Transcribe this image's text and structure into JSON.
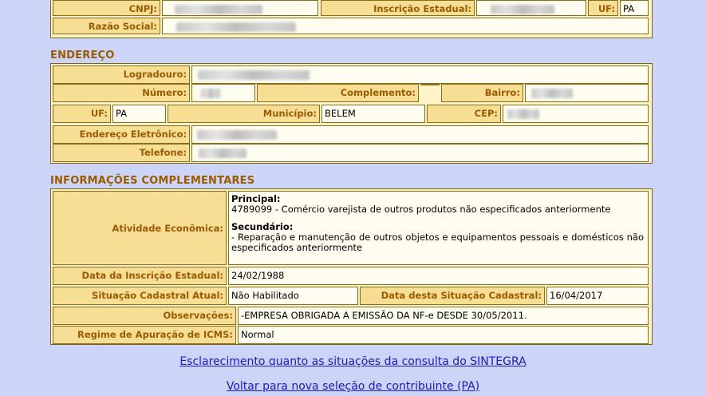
{
  "company": {
    "cnpj_label": "CNPJ:",
    "ie_label": "Inscrição Estadual:",
    "uf_label": "UF:",
    "uf_value": "PA",
    "razao_label": "Razão Social:"
  },
  "endereco": {
    "title": "ENDEREÇO",
    "logradouro_label": "Logradouro:",
    "numero_label": "Número:",
    "complemento_label": "Complemento:",
    "bairro_label": "Bairro:",
    "uf_label": "UF:",
    "uf_value": "PA",
    "municipio_label": "Município:",
    "municipio_value": "BELEM",
    "cep_label": "CEP:",
    "email_label": "Endereço Eletrônico:",
    "telefone_label": "Telefone:"
  },
  "info": {
    "title": "INFORMAÇÕES COMPLEMENTARES",
    "atividade_label": "Atividade Econômica:",
    "principal_label": "Principal:",
    "principal_value": "4789099 - Comércio varejista de outros produtos não especificados anteriormente",
    "secundario_label": "Secundário:",
    "secundario_value": "- Reparação e manutenção de outros objetos e equipamentos pessoais e domésticos não especificados anteriormente",
    "data_ie_label": "Data da Inscrição Estadual:",
    "data_ie_value": "24/02/1988",
    "situacao_label": "Situação Cadastral Atual:",
    "situacao_value": "Não Habilitado",
    "data_situacao_label": "Data desta Situação Cadastral:",
    "data_situacao_value": "16/04/2017",
    "observacoes_label": "Observações:",
    "observacoes_value": "-EMPRESA OBRIGADA A EMISSÃO DA NF-e DESDE 30/05/2011.",
    "regime_label": "Regime de Apuração de ICMS:",
    "regime_value": "Normal"
  },
  "links": {
    "esclarecimento": "Esclarecimento quanto as situações da consulta do SINTEGRA",
    "voltar": "Voltar para nova seleção de contribuinte (PA)"
  }
}
